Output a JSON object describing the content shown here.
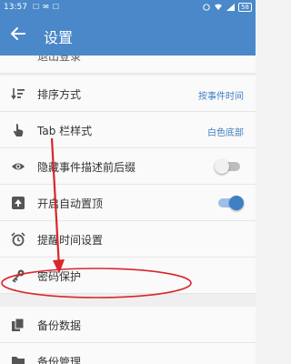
{
  "status_bar": {
    "time": "13:57",
    "right_indicators": [
      "wifi-icon",
      "signal-icon",
      "battery-icon"
    ],
    "battery": "58"
  },
  "toolbar": {
    "title": "设置",
    "back_icon": "arrow-left-icon"
  },
  "settings": {
    "logout_partial": "退出登录",
    "sort": {
      "label": "排序方式",
      "value": "按事件时间"
    },
    "tab_style": {
      "label": "Tab 栏样式",
      "value": "白色底部"
    },
    "hide_desc": {
      "label": "隐藏事件描述前后缀",
      "toggle_on": false
    },
    "auto_top": {
      "label": "开启自动置顶",
      "toggle_on": true
    },
    "reminder": {
      "label": "提醒时间设置"
    },
    "password": {
      "label": "密码保护"
    },
    "backup": {
      "label": "备份数据"
    },
    "backup_manage": {
      "label": "备份管理"
    }
  },
  "annotation": {
    "color": "#d9262b",
    "shape": "ellipse-with-arrow",
    "target": "密码保护"
  },
  "colors": {
    "primary": "#4a88c9",
    "accent_text": "#3f7fc3"
  }
}
